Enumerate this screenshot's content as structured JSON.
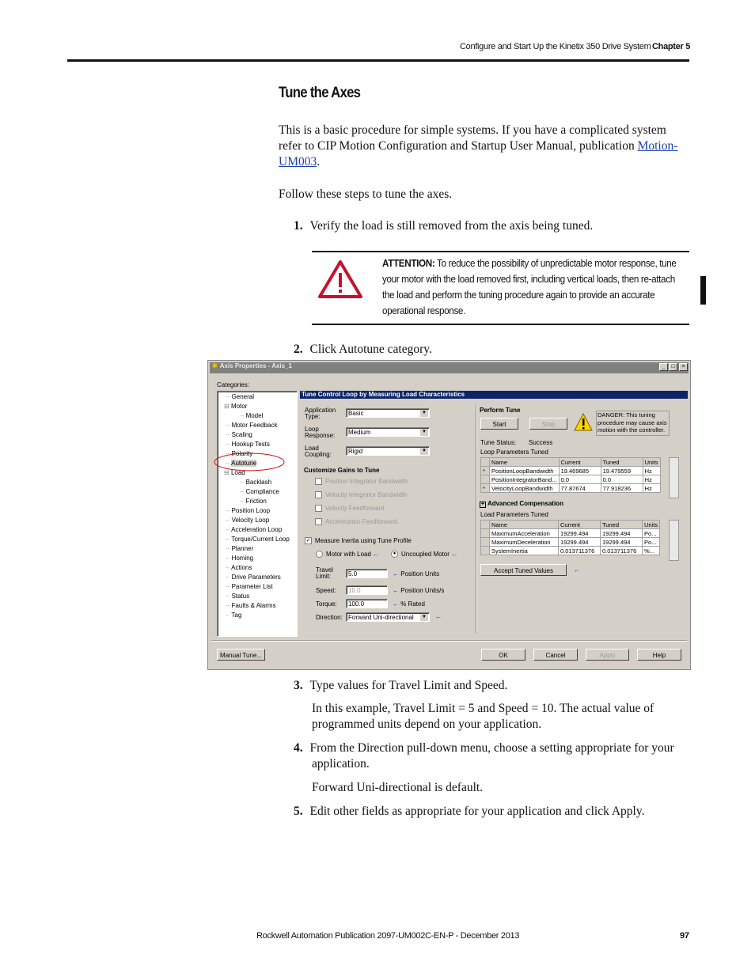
{
  "header": {
    "running_title": "Configure and Start Up the Kinetix 350 Drive System",
    "chapter": "Chapter 5"
  },
  "section_title": "Tune the Axes",
  "intro": {
    "text_before": "This is a basic procedure for simple systems. If you have a complicated system refer to CIP Motion Configuration and Startup User Manual, publication ",
    "link": "Motion-UM003",
    "text_after": "."
  },
  "follow": "Follow these steps to tune the axes.",
  "steps": [
    {
      "num": "1.",
      "text": "Verify the load is still removed from the axis being tuned."
    },
    {
      "num": "2.",
      "text": "Click Autotune category."
    },
    {
      "num": "3.",
      "text": "Type values for Travel Limit and Speed.",
      "sub": [
        "In this example, Travel Limit = 5 and Speed = 10. The actual value of programmed units depend on your application."
      ]
    },
    {
      "num": "4.",
      "text": "From the Direction pull-down menu, choose a setting appropriate for your application.",
      "sub": [
        "Forward Uni-directional is default."
      ]
    },
    {
      "num": "5.",
      "text": "Edit other fields as appropriate for your application and click Apply."
    }
  ],
  "attention": {
    "label": "ATTENTION:",
    "text": " To reduce the possibility of unpredictable motor response, tune your motor with the load removed first, including vertical loads, then re-attach the load and perform the tuning procedure again to provide an accurate operational response.",
    "icon": "warning-triangle-icon",
    "color": "#c8102e"
  },
  "dialog": {
    "title": "Axis Properties - Axis_1",
    "categories_label": "Categories:",
    "tree": [
      "General",
      "Motor",
      "Model",
      "Motor Feedback",
      "Scaling",
      "Hookup Tests",
      "Polarity",
      "Autotune",
      "Load",
      "Backlash",
      "Compliance",
      "Friction",
      "Position Loop",
      "Velocity Loop",
      "Acceleration Loop",
      "Torque/Current Loop",
      "Planner",
      "Homing",
      "Actions",
      "Drive Parameters",
      "Parameter List",
      "Status",
      "Faults & Alarms",
      "Tag"
    ],
    "selected": "Autotune",
    "section_header": "Tune Control Loop by Measuring Load Characteristics",
    "application_type": {
      "label": "Application Type:",
      "value": "Basic"
    },
    "loop_response": {
      "label": "Loop Response:",
      "value": "Medium"
    },
    "load_coupling": {
      "label": "Load Coupling:",
      "value": "Rigid"
    },
    "customize_label": "Customize Gains to Tune",
    "customize": [
      "Position Integrator Bandwidth",
      "Velocity Integrator Bandwidth",
      "Velocity Feedforward",
      "Acceleration Feedforward"
    ],
    "measure_inertia": {
      "label": "Measure Inertia using Tune Profile",
      "checked": true
    },
    "radio": [
      {
        "label": "Motor with Load",
        "selected": false
      },
      {
        "label": "Uncoupled Motor",
        "selected": true
      }
    ],
    "travel_limit": {
      "label": "Travel Limit:",
      "value": "5.0",
      "units": "Position Units"
    },
    "speed": {
      "label": "Speed:",
      "value": "10.0",
      "units": "Position Units/s"
    },
    "torque": {
      "label": "Torque:",
      "value": "100.0",
      "units": "% Rated"
    },
    "direction": {
      "label": "Direction:",
      "value": "Forward Uni-directional"
    },
    "perform_tune": "Perform Tune",
    "start": "Start",
    "stop": "Stop",
    "danger": "DANGER: This tuning procedure may cause axis motion with the controller.",
    "tune_status_label": "Tune Status:",
    "tune_status": "Success",
    "loop_params_label": "Loop Parameters Tuned",
    "columns": [
      "Name",
      "Current",
      "Tuned",
      "Units"
    ],
    "loop_params": [
      [
        "*",
        "PositionLoopBandwidth",
        "19.469685",
        "19.479559",
        "Hz"
      ],
      [
        "",
        "PositionIntegratorBand...",
        "0.0",
        "0.0",
        "Hz"
      ],
      [
        "*",
        "VelocityLoopBandwidth",
        "77.87674",
        "77.918236",
        "Hz"
      ]
    ],
    "advanced": "Advanced Compensation",
    "load_params_label": "Load Parameters Tuned",
    "load_params": [
      [
        "",
        "MaximumAcceleration",
        "19299.494",
        "19299.494",
        "Po..."
      ],
      [
        "",
        "MaximumDeceleration",
        "19299.494",
        "19299.494",
        "Po..."
      ],
      [
        "",
        "SystemInertia",
        "0.013711376",
        "0.013711376",
        "%..."
      ]
    ],
    "accept": "Accept Tuned Values",
    "manual_tune": "Manual Tune...",
    "ok": "OK",
    "cancel": "Cancel",
    "apply": "Apply",
    "help": "Help"
  },
  "footer": {
    "publication": "Rockwell Automation Publication 2097-UM002C-EN-P - December 2013",
    "page": "97"
  }
}
